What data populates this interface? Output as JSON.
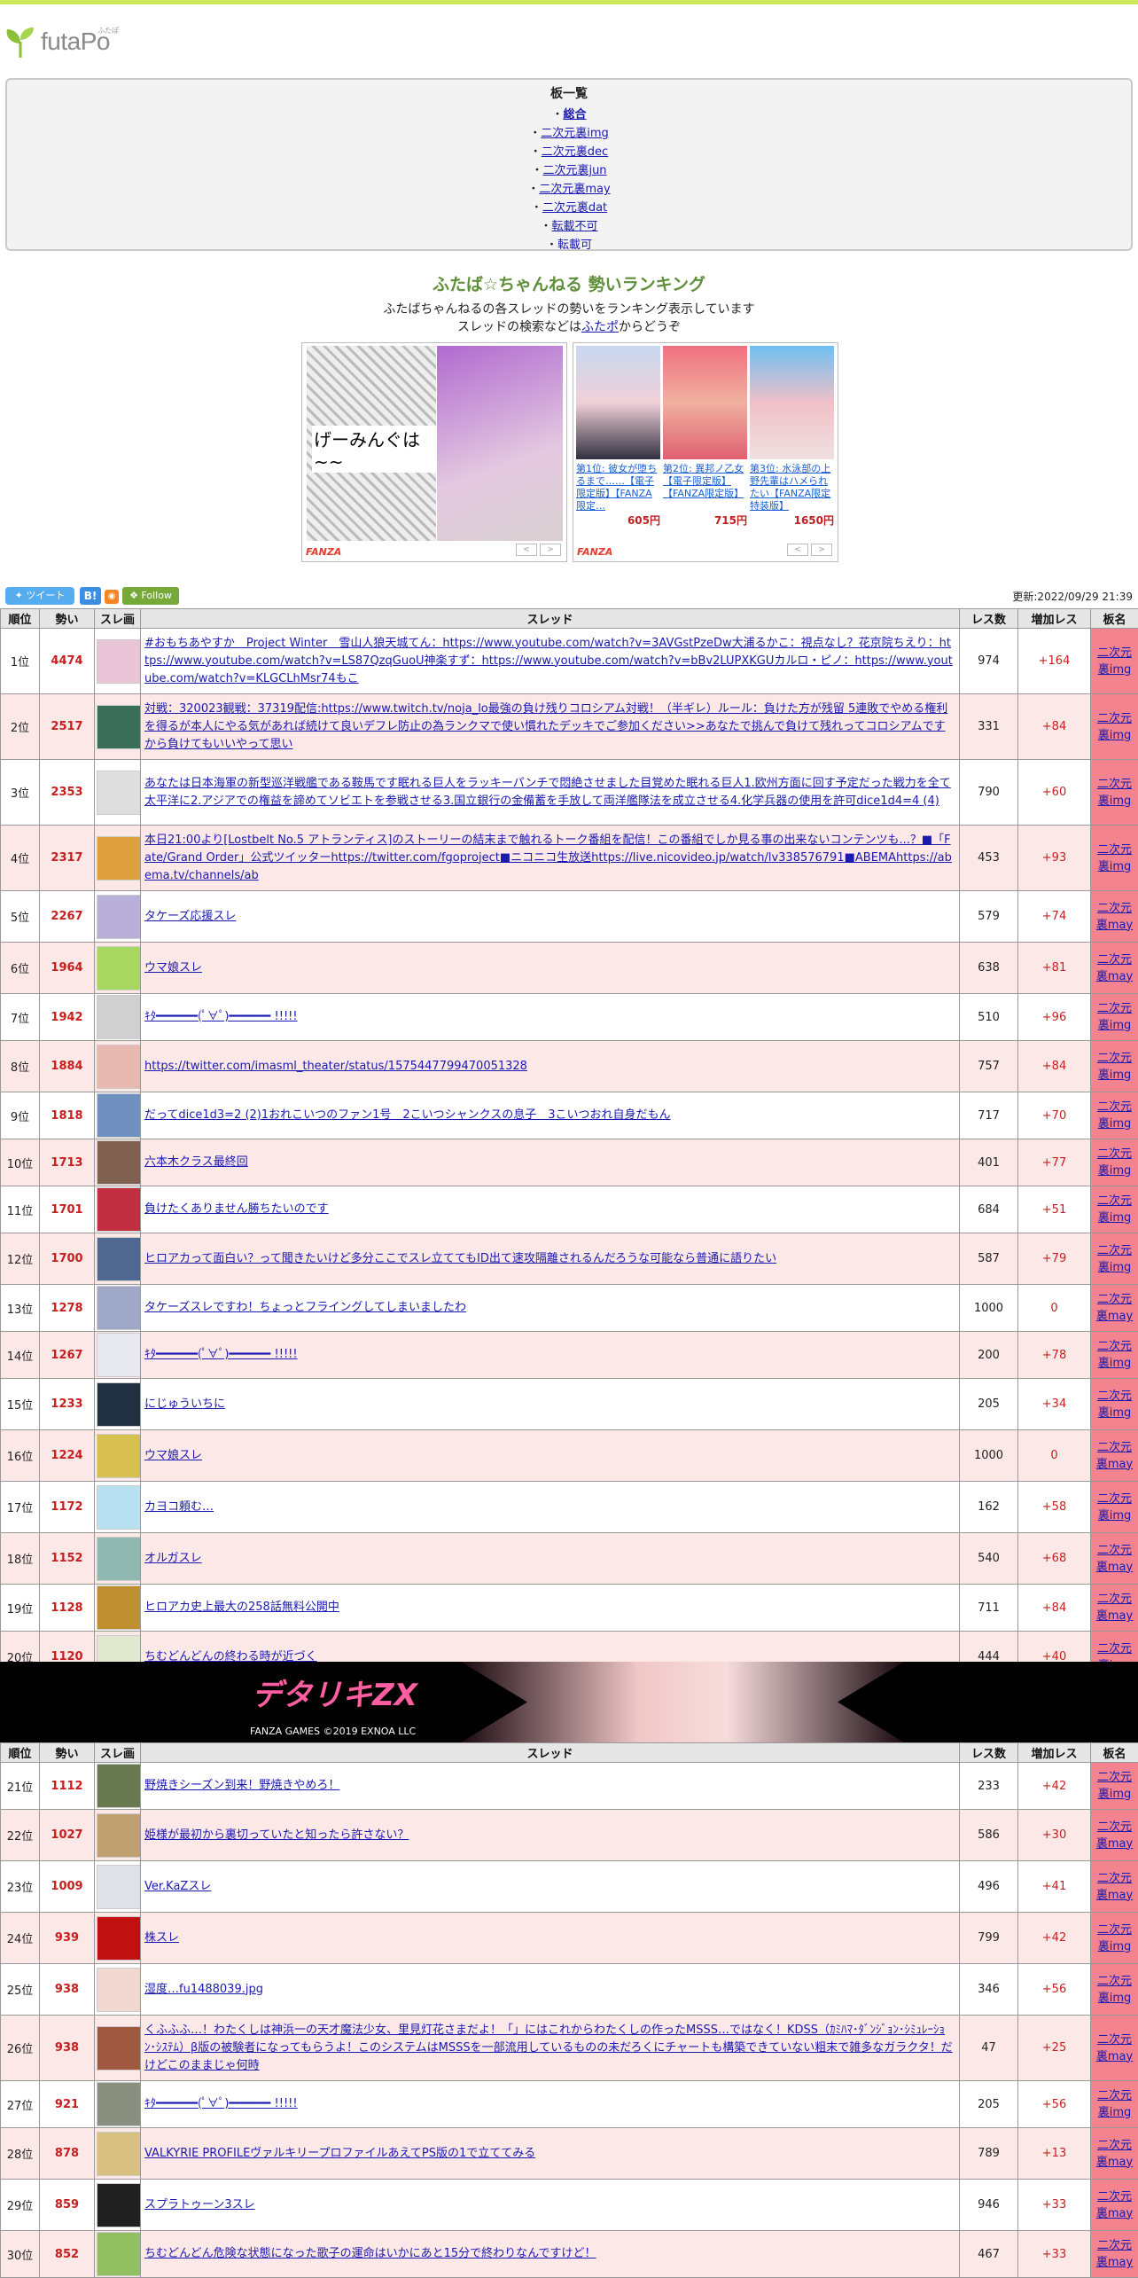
{
  "site": {
    "logo_text": "futaPo",
    "logo_ruby": "ふたぽ"
  },
  "boards": {
    "title": "板一覧",
    "items": [
      {
        "label": "総合",
        "current": true
      },
      {
        "label": "二次元裏img"
      },
      {
        "label": "二次元裏dec"
      },
      {
        "label": "二次元裏jun"
      },
      {
        "label": "二次元裏may"
      },
      {
        "label": "二次元裏dat"
      },
      {
        "label": "転載不可"
      },
      {
        "label": "転載可"
      }
    ]
  },
  "hero": {
    "title": "ふたば☆ちゃんねる 勢いランキング",
    "desc1": "ふたばちゃんねるの各スレッドの勢いをランキング表示しています",
    "desc2_pre": "スレッドの検索などは",
    "desc2_link": "ふたポ",
    "desc2_post": "からどうぞ"
  },
  "ads": {
    "brand": "FANZA",
    "left_text": "げーみんぐは~~",
    "items": [
      {
        "title": "第1位: 彼女が堕ちるまで……【電子限定版】【FANZA限定…",
        "price": "605円"
      },
      {
        "title": "第2位: 異邦ノ乙女【電子限定版】【FANZA限定版】",
        "price": "715円"
      },
      {
        "title": "第3位: 水泳部の上野先輩はハメられたい【FANZA限定特装版】",
        "price": "1650円"
      }
    ],
    "prev": "<",
    "next": ">"
  },
  "social": {
    "tweet": "ツイート",
    "hatena": "B!",
    "rss": "rss",
    "follow": "Follow"
  },
  "updated": "更新:2022/09/29 21:39",
  "table": {
    "headers": [
      "順位",
      "勢い",
      "スレ画",
      "スレッド",
      "レス数",
      "増加レス",
      "板名"
    ],
    "rows": [
      {
        "rank": "1位",
        "momentum": "4474",
        "title": "#おもちあやすか　Project Winter　雪山人狼天城てん：https://www.youtube.com/watch?v=3AVGstPzeDw大浦るかこ：視点なし？花京院ちえり：https://www.youtube.com/watch?v=LS87QzqGuoU神楽すず：https://www.youtube.com/watch?v=bBv2LUPXKGUカルロ・ピノ：https://www.youtube.com/watch?v=KLGCLhMsr74もこ",
        "res": "974",
        "inc": "+164",
        "board": "二次元裏img",
        "thumb": "#e9c3d6"
      },
      {
        "rank": "2位",
        "momentum": "2517",
        "title": "対戦：320023観戦：37319配信:https://www.twitch.tv/noja_lo最強の負け残りコロシアム対戦！（半ギレ）ルール：負けた方が残留 5連敗でやめる権利を得るが本人にやる気があれば続けて良いデフレ防止の為ランクマで使い慣れたデッキでご参加ください>>あなたで挑んで負けて残れってコロシアムですから負けてもいいやって思い",
        "res": "331",
        "inc": "+84",
        "board": "二次元裏img",
        "thumb": "#3b6e58"
      },
      {
        "rank": "3位",
        "momentum": "2353",
        "title": "あなたは日本海軍の新型巡洋戦艦である鞍馬です眠れる巨人をラッキーパンチで悶絶させました目覚めた眠れる巨人1.欧州方面に回す予定だった戦力を全て太平洋に2.アジアでの権益を諦めてソビエトを参戦させる3.国立銀行の金備蓄を手放して両洋艦隊法を成立させる4.化学兵器の使用を許可dice1d4=4 (4)",
        "res": "790",
        "inc": "+60",
        "board": "二次元裏img",
        "thumb": "#dedede"
      },
      {
        "rank": "4位",
        "momentum": "2317",
        "title": "本日21:00より[Lostbelt No.5 アトランティス]のストーリーの結末まで触れるトーク番組を配信！この番組でしか見る事の出来ないコンテンツも...？■「Fate/Grand Order」公式ツイッターhttps://twitter.com/fgoproject■ニコニコ生放送https://live.nicovideo.jp/watch/lv338576791■ABEMAhttps://abema.tv/channels/ab",
        "res": "453",
        "inc": "+93",
        "board": "二次元裏img",
        "thumb": "#e0a040"
      },
      {
        "rank": "5位",
        "momentum": "2267",
        "title": "タケーズ応援スレ",
        "res": "579",
        "inc": "+74",
        "board": "二次元裏may",
        "thumb": "#b8b0d8"
      },
      {
        "rank": "6位",
        "momentum": "1964",
        "title": "ウマ娘スレ",
        "res": "638",
        "inc": "+81",
        "board": "二次元裏may",
        "thumb": "#a8d860"
      },
      {
        "rank": "7位",
        "momentum": "1942",
        "title": "ｷﾀ━━━━━━(ﾟ∀ﾟ)━━━━━━ !!!!!",
        "res": "510",
        "inc": "+96",
        "board": "二次元裏img",
        "thumb": "#d0d0d0"
      },
      {
        "rank": "8位",
        "momentum": "1884",
        "title": "https://twitter.com/imasml_theater/status/1575447799470051328",
        "res": "757",
        "inc": "+84",
        "board": "二次元裏img",
        "thumb": "#e6b8b0"
      },
      {
        "rank": "9位",
        "momentum": "1818",
        "title": "だってdice1d3=2 (2)1おれこいつのファン1号　2こいつシャンクスの息子　3こいつおれ自身だもん",
        "res": "717",
        "inc": "+70",
        "board": "二次元裏img",
        "thumb": "#7090c0"
      },
      {
        "rank": "10位",
        "momentum": "1713",
        "title": "六本木クラス最終回",
        "res": "401",
        "inc": "+77",
        "board": "二次元裏img",
        "thumb": "#806050"
      },
      {
        "rank": "11位",
        "momentum": "1701",
        "title": "負けたくありません勝ちたいのです",
        "res": "684",
        "inc": "+51",
        "board": "二次元裏img",
        "thumb": "#c03040"
      },
      {
        "rank": "12位",
        "momentum": "1700",
        "title": "ヒロアカって面白い？って聞きたいけど多分ここでスレ立ててもID出て速攻隔離されるんだろうな可能なら普通に語りたい",
        "res": "587",
        "inc": "+79",
        "board": "二次元裏img",
        "thumb": "#506890"
      },
      {
        "rank": "13位",
        "momentum": "1278",
        "title": "タケーズスレですわ！ちょっとフライングしてしまいましたわ",
        "res": "1000",
        "inc": "0",
        "board": "二次元裏may",
        "thumb": "#a0a8c8"
      },
      {
        "rank": "14位",
        "momentum": "1267",
        "title": "ｷﾀ━━━━━━(ﾟ∀ﾟ)━━━━━━ !!!!!",
        "res": "200",
        "inc": "+78",
        "board": "二次元裏img",
        "thumb": "#e8e8f0"
      },
      {
        "rank": "15位",
        "momentum": "1233",
        "title": "にじゅういちに",
        "res": "205",
        "inc": "+34",
        "board": "二次元裏img",
        "thumb": "#203040"
      },
      {
        "rank": "16位",
        "momentum": "1224",
        "title": "ウマ娘スレ",
        "res": "1000",
        "inc": "0",
        "board": "二次元裏may",
        "thumb": "#d8c050"
      },
      {
        "rank": "17位",
        "momentum": "1172",
        "title": "カヨコ頼む…",
        "res": "162",
        "inc": "+58",
        "board": "二次元裏img",
        "thumb": "#b8e0f0"
      },
      {
        "rank": "18位",
        "momentum": "1152",
        "title": "オルガスレ",
        "res": "540",
        "inc": "+68",
        "board": "二次元裏may",
        "thumb": "#90b8b0"
      },
      {
        "rank": "19位",
        "momentum": "1128",
        "title": "ヒロアカ史上最大の258話無料公開中",
        "res": "711",
        "inc": "+84",
        "board": "二次元裏may",
        "thumb": "#c09030"
      },
      {
        "rank": "20位",
        "momentum": "1120",
        "title": "ちむどんどんの終わる時が近づく",
        "res": "444",
        "inc": "+40",
        "board": "二次元裏img",
        "thumb": "#e0e8d0"
      },
      {
        "rank": "21位",
        "momentum": "1112",
        "title": "野焼きシーズン到来！野焼きやめろ！",
        "res": "233",
        "inc": "+42",
        "board": "二次元裏img",
        "thumb": "#6a7a50"
      },
      {
        "rank": "22位",
        "momentum": "1027",
        "title": "姫様が最初から裏切っていたと知ったら許さない？",
        "res": "586",
        "inc": "+30",
        "board": "二次元裏may",
        "thumb": "#c0a070"
      },
      {
        "rank": "23位",
        "momentum": "1009",
        "title": "Ver.KaZスレ",
        "res": "496",
        "inc": "+41",
        "board": "二次元裏may",
        "thumb": "#e0e0e8"
      },
      {
        "rank": "24位",
        "momentum": "939",
        "title": "株スレ",
        "res": "799",
        "inc": "+42",
        "board": "二次元裏img",
        "thumb": "#c01010"
      },
      {
        "rank": "25位",
        "momentum": "938",
        "title": "湿度…fu1488039.jpg",
        "res": "346",
        "inc": "+56",
        "board": "二次元裏img",
        "thumb": "#f0d8d0"
      },
      {
        "rank": "26位",
        "momentum": "938",
        "title": "くふふふ…！わたくしは神浜一の天才魔法少女、里見灯花さまだよ！「」にはこれからわたくしの作ったMSSS…ではなく！KDSS（ｶﾐﾊﾏ･ﾀﾞﾝｼﾞｮﾝ･ｼﾐｭﾚｰｼｮﾝ･ｼｽﾃﾑ）β版の被験者になってもらうよ！このシステムはMSSSを一部流用しているものの未だろくにチャートも構築できていない粗末で雑多なガラクタ！だけどこのままじゃ何時",
        "res": "47",
        "inc": "+25",
        "board": "二次元裏may",
        "thumb": "#a05840"
      },
      {
        "rank": "27位",
        "momentum": "921",
        "title": "ｷﾀ━━━━━━(ﾟ∀ﾟ)━━━━━━ !!!!!",
        "res": "205",
        "inc": "+56",
        "board": "二次元裏img",
        "thumb": "#8a9080"
      },
      {
        "rank": "28位",
        "momentum": "878",
        "title": "VALKYRIE PROFILEヴァルキリープロファイルあえてPS版の1で立ててみる",
        "res": "789",
        "inc": "+13",
        "board": "二次元裏may",
        "thumb": "#d8c080"
      },
      {
        "rank": "29位",
        "momentum": "859",
        "title": "スプラトゥーン3スレ",
        "res": "946",
        "inc": "+33",
        "board": "二次元裏may",
        "thumb": "#202020"
      },
      {
        "rank": "30位",
        "momentum": "852",
        "title": "ちむどんどん危険な状態になった歌子の運命はいかにあと15分で終わりなんですけど！",
        "res": "467",
        "inc": "+33",
        "board": "二次元裏may",
        "thumb": "#90c060"
      }
    ]
  },
  "banner": {
    "logo": "デタリキZX",
    "copyright": "FANZA GAMES ©2019 EXNOA LLC"
  }
}
